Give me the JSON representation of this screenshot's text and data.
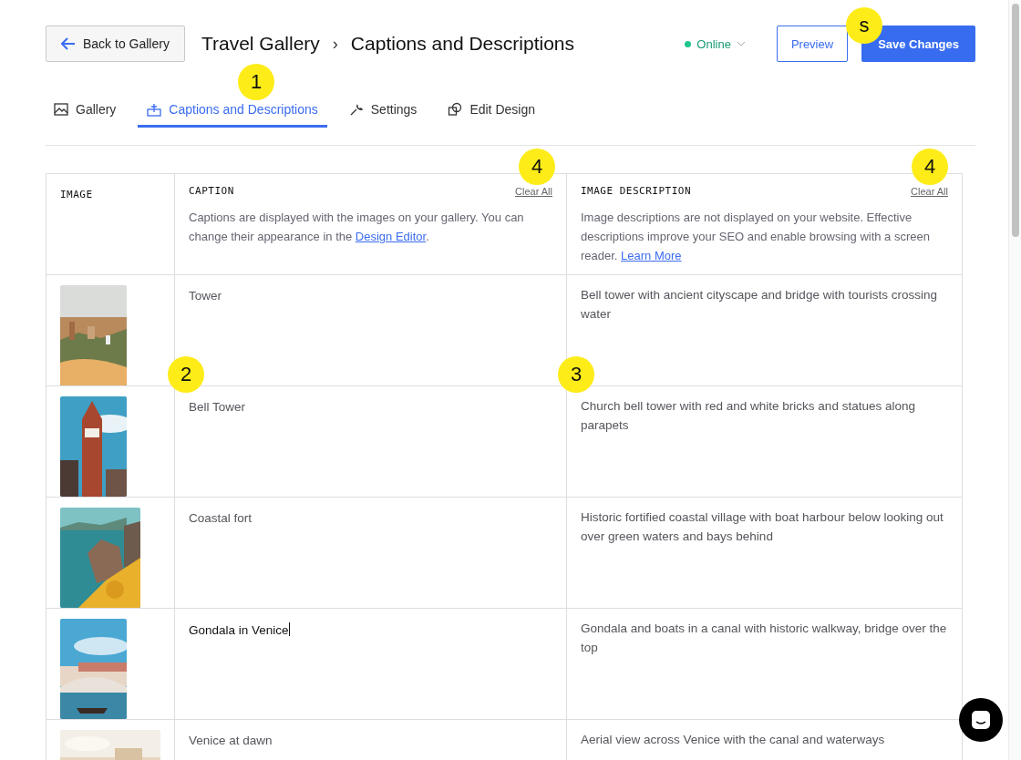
{
  "header": {
    "back_button": "Back to Gallery",
    "breadcrumb": [
      "Travel Gallery",
      "Captions and Descriptions"
    ],
    "separator": "›",
    "status": "Online",
    "preview_button": "Preview",
    "save_button": "Save Changes"
  },
  "tabs": [
    {
      "label": "Gallery",
      "selected": false
    },
    {
      "label": "Captions and Descriptions",
      "selected": true
    },
    {
      "label": "Settings",
      "selected": false
    },
    {
      "label": "Edit Design",
      "selected": false
    }
  ],
  "table": {
    "columns": [
      {
        "label": "IMAGE"
      },
      {
        "label": "CAPTION",
        "action": "Clear All",
        "note": "Captions are displayed with the images on your gallery. You can change their appearance in the ",
        "link": "Design Editor",
        "note_end": "."
      },
      {
        "label": "IMAGE DESCRIPTION",
        "action": "Clear All",
        "note": "Image descriptions are not displayed on your website. Effective descriptions improve your SEO and enable browsing with a screen reader. ",
        "link": "Learn More"
      }
    ],
    "rows": [
      {
        "caption": "Tower",
        "description": "Bell tower with ancient cityscape and bridge with tourists crossing water",
        "focused": false
      },
      {
        "caption": "Bell Tower",
        "description": "Church bell tower with red and white bricks and statues along parapets",
        "focused": false
      },
      {
        "caption": "Coastal fort",
        "description": "Historic fortified coastal village with boat harbour below looking out over green waters and bays behind",
        "focused": false
      },
      {
        "caption": "Gondala in Venice",
        "description": "Gondala and boats in a canal with historic walkway, bridge over the top",
        "focused": true
      },
      {
        "caption": "Venice at dawn",
        "description": "Aerial view across Venice with the canal and waterways",
        "focused": false
      }
    ]
  },
  "markers": [
    {
      "label": "s"
    },
    {
      "label": "1"
    },
    {
      "label": "4"
    },
    {
      "label": "4"
    },
    {
      "label": "2"
    },
    {
      "label": "3"
    }
  ]
}
